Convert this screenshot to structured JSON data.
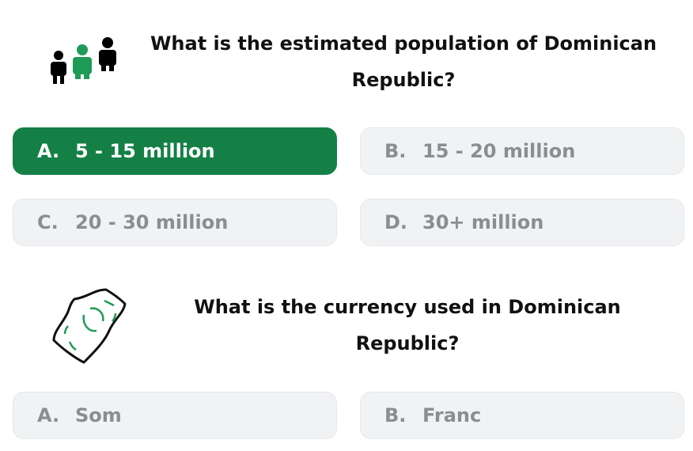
{
  "questions": [
    {
      "text": "What is the estimated population of Dominican Republic?",
      "icon": "people-icon",
      "options": [
        {
          "letter": "A.",
          "text": "5 - 15 million",
          "selected": true
        },
        {
          "letter": "B.",
          "text": "15 - 20 million",
          "selected": false
        },
        {
          "letter": "C.",
          "text": "20 - 30 million",
          "selected": false
        },
        {
          "letter": "D.",
          "text": "30+ million",
          "selected": false
        }
      ]
    },
    {
      "text": "What is the currency used in Dominican Republic?",
      "icon": "banknote-icon",
      "options": [
        {
          "letter": "A.",
          "text": "Som",
          "selected": false
        },
        {
          "letter": "B.",
          "text": "Franc",
          "selected": false
        }
      ]
    }
  ],
  "colors": {
    "selected_bg": "#158046",
    "option_bg": "#f1f2f4",
    "option_text": "#8a8d92",
    "icon_green": "#1e9b57"
  }
}
